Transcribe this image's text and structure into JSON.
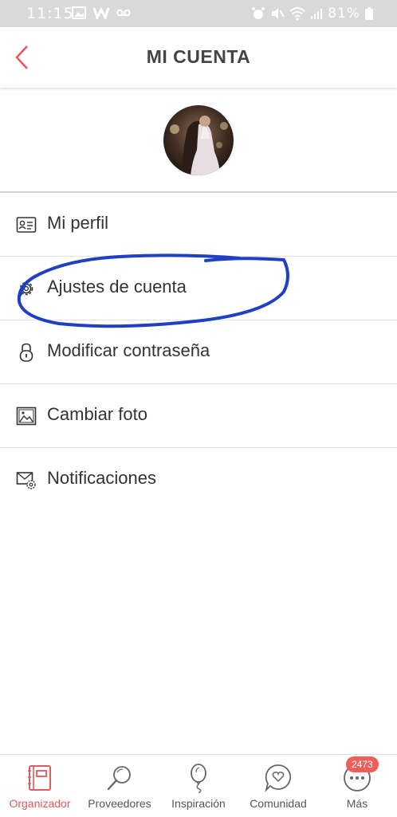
{
  "status_bar": {
    "time": "11:15",
    "battery": "81%"
  },
  "header": {
    "title": "MI CUENTA"
  },
  "menu": {
    "items": [
      {
        "label": "Mi perfil",
        "icon": "id-card-icon"
      },
      {
        "label": "Ajustes de cuenta",
        "icon": "gear-icon"
      },
      {
        "label": "Modificar contraseña",
        "icon": "lock-icon"
      },
      {
        "label": "Cambiar foto",
        "icon": "image-icon"
      },
      {
        "label": "Notificaciones",
        "icon": "mail-settings-icon"
      }
    ]
  },
  "bottom_nav": {
    "items": [
      {
        "label": "Organizador",
        "icon": "planner-icon",
        "active": true
      },
      {
        "label": "Proveedores",
        "icon": "search-icon"
      },
      {
        "label": "Inspiración",
        "icon": "balloon-icon"
      },
      {
        "label": "Comunidad",
        "icon": "chat-heart-icon"
      },
      {
        "label": "Más",
        "icon": "more-icon",
        "badge": "2473"
      }
    ]
  },
  "colors": {
    "accent": "#e25a5a",
    "scribble": "#1f3fc4"
  }
}
